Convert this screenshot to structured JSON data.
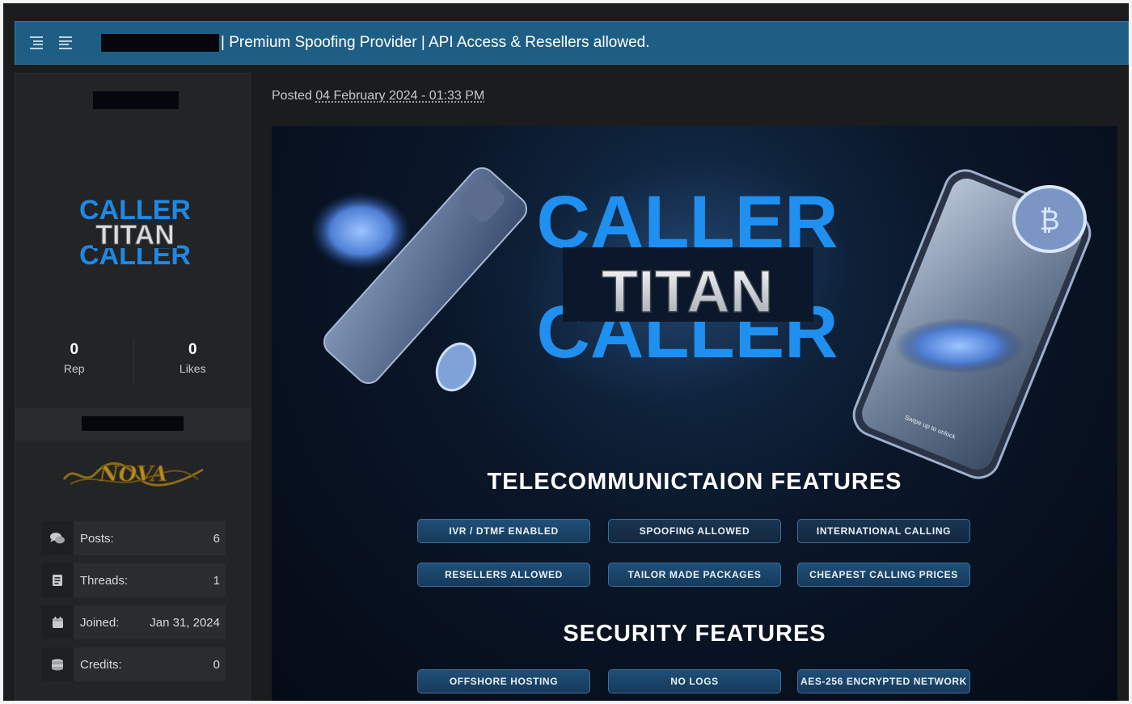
{
  "thread": {
    "title": "| Premium Spoofing Provider | API Access & Resellers allowed."
  },
  "post": {
    "posted_prefix": "Posted",
    "posted_date": "04 February 2024 - 01:33 PM"
  },
  "user": {
    "avatar_logo": {
      "word_top": "CALLER",
      "word_main": "TITAN",
      "word_bottom": "CALLER"
    },
    "rep_value": "0",
    "rep_label": "Rep",
    "likes_value": "0",
    "likes_label": "Likes",
    "badge_text": "NOVA",
    "info": [
      {
        "icon": "chat-bubbles-icon",
        "label": "Posts:",
        "value": "6"
      },
      {
        "icon": "document-icon",
        "label": "Threads:",
        "value": "1"
      },
      {
        "icon": "calendar-icon",
        "label": "Joined:",
        "value": "Jan 31, 2024"
      },
      {
        "icon": "coins-icon",
        "label": "Credits:",
        "value": "0"
      }
    ]
  },
  "banner": {
    "logo_top": "CALLER",
    "logo_main": "TITAN",
    "logo_bottom": "CALLER",
    "phone_lock_text": "Swipe up to unlock",
    "telecom_heading": "TELECOMMUNICTAION FEATURES",
    "telecom_features": [
      "IVR / DTMF ENABLED",
      "SPOOFING ALLOWED",
      "INTERNATIONAL CALLING",
      "RESELLERS ALLOWED",
      "TAILOR MADE PACKAGES",
      "CHEAPEST CALLING PRICES"
    ],
    "security_heading": "SECURITY FEATURES",
    "security_features": [
      "OFFSHORE HOSTING",
      "NO LOGS",
      "AES-256 ENCRYPTED NETWORK"
    ]
  },
  "colors": {
    "header_bar": "#1f5e84",
    "logo_blue": "#1e88e5",
    "panel_bg": "#232426"
  }
}
